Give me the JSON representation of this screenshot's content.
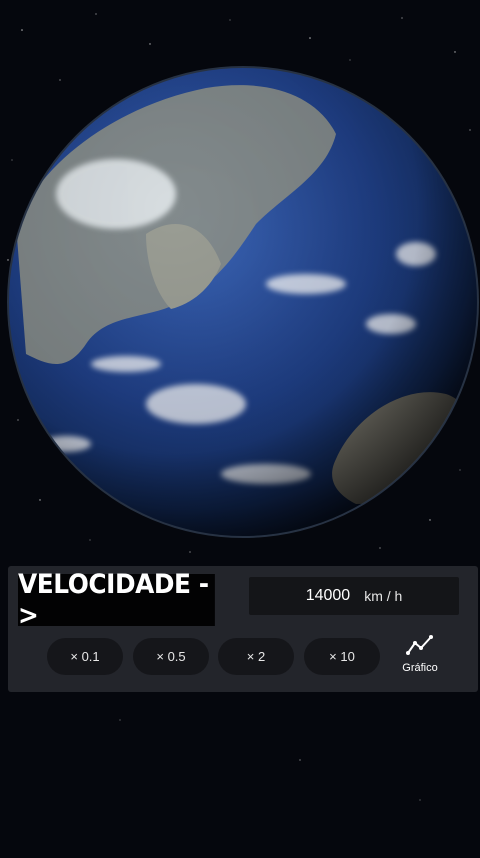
{
  "scene": {
    "background": "#05070d",
    "planet_icon": "earth-globe"
  },
  "panel": {
    "velocity_label": "VELOCIDADE ->",
    "speed_value": "14000",
    "speed_unit": "km / h",
    "multipliers": [
      "× 0.1",
      "× 0.5",
      "× 2",
      "× 10"
    ],
    "graph_label": "Gráfico",
    "graph_icon": "line-chart-icon"
  }
}
